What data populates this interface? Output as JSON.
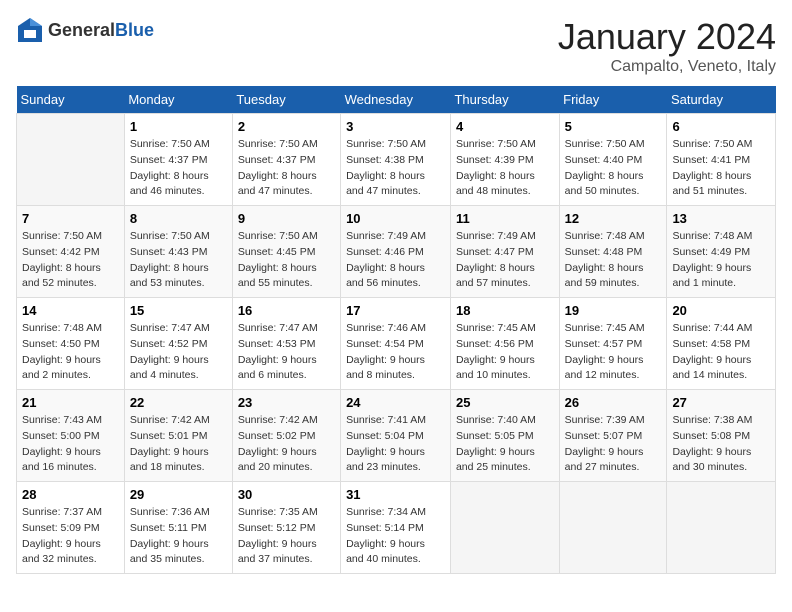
{
  "logo": {
    "general": "General",
    "blue": "Blue"
  },
  "title": "January 2024",
  "location": "Campalto, Veneto, Italy",
  "weekdays": [
    "Sunday",
    "Monday",
    "Tuesday",
    "Wednesday",
    "Thursday",
    "Friday",
    "Saturday"
  ],
  "weeks": [
    [
      {
        "day": "",
        "sunrise": "",
        "sunset": "",
        "daylight": ""
      },
      {
        "day": "1",
        "sunrise": "Sunrise: 7:50 AM",
        "sunset": "Sunset: 4:37 PM",
        "daylight": "Daylight: 8 hours and 46 minutes."
      },
      {
        "day": "2",
        "sunrise": "Sunrise: 7:50 AM",
        "sunset": "Sunset: 4:37 PM",
        "daylight": "Daylight: 8 hours and 47 minutes."
      },
      {
        "day": "3",
        "sunrise": "Sunrise: 7:50 AM",
        "sunset": "Sunset: 4:38 PM",
        "daylight": "Daylight: 8 hours and 47 minutes."
      },
      {
        "day": "4",
        "sunrise": "Sunrise: 7:50 AM",
        "sunset": "Sunset: 4:39 PM",
        "daylight": "Daylight: 8 hours and 48 minutes."
      },
      {
        "day": "5",
        "sunrise": "Sunrise: 7:50 AM",
        "sunset": "Sunset: 4:40 PM",
        "daylight": "Daylight: 8 hours and 50 minutes."
      },
      {
        "day": "6",
        "sunrise": "Sunrise: 7:50 AM",
        "sunset": "Sunset: 4:41 PM",
        "daylight": "Daylight: 8 hours and 51 minutes."
      }
    ],
    [
      {
        "day": "7",
        "sunrise": "Sunrise: 7:50 AM",
        "sunset": "Sunset: 4:42 PM",
        "daylight": "Daylight: 8 hours and 52 minutes."
      },
      {
        "day": "8",
        "sunrise": "Sunrise: 7:50 AM",
        "sunset": "Sunset: 4:43 PM",
        "daylight": "Daylight: 8 hours and 53 minutes."
      },
      {
        "day": "9",
        "sunrise": "Sunrise: 7:50 AM",
        "sunset": "Sunset: 4:45 PM",
        "daylight": "Daylight: 8 hours and 55 minutes."
      },
      {
        "day": "10",
        "sunrise": "Sunrise: 7:49 AM",
        "sunset": "Sunset: 4:46 PM",
        "daylight": "Daylight: 8 hours and 56 minutes."
      },
      {
        "day": "11",
        "sunrise": "Sunrise: 7:49 AM",
        "sunset": "Sunset: 4:47 PM",
        "daylight": "Daylight: 8 hours and 57 minutes."
      },
      {
        "day": "12",
        "sunrise": "Sunrise: 7:48 AM",
        "sunset": "Sunset: 4:48 PM",
        "daylight": "Daylight: 8 hours and 59 minutes."
      },
      {
        "day": "13",
        "sunrise": "Sunrise: 7:48 AM",
        "sunset": "Sunset: 4:49 PM",
        "daylight": "Daylight: 9 hours and 1 minute."
      }
    ],
    [
      {
        "day": "14",
        "sunrise": "Sunrise: 7:48 AM",
        "sunset": "Sunset: 4:50 PM",
        "daylight": "Daylight: 9 hours and 2 minutes."
      },
      {
        "day": "15",
        "sunrise": "Sunrise: 7:47 AM",
        "sunset": "Sunset: 4:52 PM",
        "daylight": "Daylight: 9 hours and 4 minutes."
      },
      {
        "day": "16",
        "sunrise": "Sunrise: 7:47 AM",
        "sunset": "Sunset: 4:53 PM",
        "daylight": "Daylight: 9 hours and 6 minutes."
      },
      {
        "day": "17",
        "sunrise": "Sunrise: 7:46 AM",
        "sunset": "Sunset: 4:54 PM",
        "daylight": "Daylight: 9 hours and 8 minutes."
      },
      {
        "day": "18",
        "sunrise": "Sunrise: 7:45 AM",
        "sunset": "Sunset: 4:56 PM",
        "daylight": "Daylight: 9 hours and 10 minutes."
      },
      {
        "day": "19",
        "sunrise": "Sunrise: 7:45 AM",
        "sunset": "Sunset: 4:57 PM",
        "daylight": "Daylight: 9 hours and 12 minutes."
      },
      {
        "day": "20",
        "sunrise": "Sunrise: 7:44 AM",
        "sunset": "Sunset: 4:58 PM",
        "daylight": "Daylight: 9 hours and 14 minutes."
      }
    ],
    [
      {
        "day": "21",
        "sunrise": "Sunrise: 7:43 AM",
        "sunset": "Sunset: 5:00 PM",
        "daylight": "Daylight: 9 hours and 16 minutes."
      },
      {
        "day": "22",
        "sunrise": "Sunrise: 7:42 AM",
        "sunset": "Sunset: 5:01 PM",
        "daylight": "Daylight: 9 hours and 18 minutes."
      },
      {
        "day": "23",
        "sunrise": "Sunrise: 7:42 AM",
        "sunset": "Sunset: 5:02 PM",
        "daylight": "Daylight: 9 hours and 20 minutes."
      },
      {
        "day": "24",
        "sunrise": "Sunrise: 7:41 AM",
        "sunset": "Sunset: 5:04 PM",
        "daylight": "Daylight: 9 hours and 23 minutes."
      },
      {
        "day": "25",
        "sunrise": "Sunrise: 7:40 AM",
        "sunset": "Sunset: 5:05 PM",
        "daylight": "Daylight: 9 hours and 25 minutes."
      },
      {
        "day": "26",
        "sunrise": "Sunrise: 7:39 AM",
        "sunset": "Sunset: 5:07 PM",
        "daylight": "Daylight: 9 hours and 27 minutes."
      },
      {
        "day": "27",
        "sunrise": "Sunrise: 7:38 AM",
        "sunset": "Sunset: 5:08 PM",
        "daylight": "Daylight: 9 hours and 30 minutes."
      }
    ],
    [
      {
        "day": "28",
        "sunrise": "Sunrise: 7:37 AM",
        "sunset": "Sunset: 5:09 PM",
        "daylight": "Daylight: 9 hours and 32 minutes."
      },
      {
        "day": "29",
        "sunrise": "Sunrise: 7:36 AM",
        "sunset": "Sunset: 5:11 PM",
        "daylight": "Daylight: 9 hours and 35 minutes."
      },
      {
        "day": "30",
        "sunrise": "Sunrise: 7:35 AM",
        "sunset": "Sunset: 5:12 PM",
        "daylight": "Daylight: 9 hours and 37 minutes."
      },
      {
        "day": "31",
        "sunrise": "Sunrise: 7:34 AM",
        "sunset": "Sunset: 5:14 PM",
        "daylight": "Daylight: 9 hours and 40 minutes."
      },
      {
        "day": "",
        "sunrise": "",
        "sunset": "",
        "daylight": ""
      },
      {
        "day": "",
        "sunrise": "",
        "sunset": "",
        "daylight": ""
      },
      {
        "day": "",
        "sunrise": "",
        "sunset": "",
        "daylight": ""
      }
    ]
  ]
}
